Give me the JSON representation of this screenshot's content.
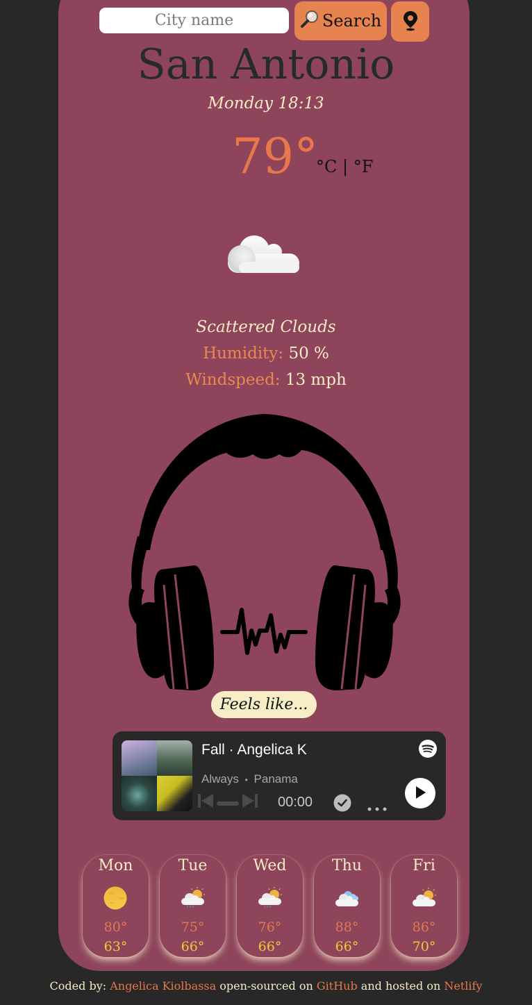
{
  "search": {
    "placeholder": "City name",
    "value": "",
    "button_label": "Search",
    "button_icon": "magnifier-icon",
    "location_icon": "map-pin-icon"
  },
  "current": {
    "city": "San Antonio",
    "datetime": "Monday 18:13",
    "temperature": "79°",
    "unit_celsius": "°C",
    "unit_separator": " | ",
    "unit_fahrenheit": "°F",
    "icon": "scattered-clouds-icon",
    "description": "Scattered Clouds",
    "humidity_label": "Humidity:",
    "humidity_value": "50 %",
    "wind_label": "Windspeed:",
    "wind_value": "13 mph"
  },
  "music": {
    "illustration": "headphones-icon",
    "feels_like_label": "Feels like...",
    "player": {
      "track_title": "Fall · Angelica K",
      "subtitle_song": "Always",
      "subtitle_separator": "•",
      "subtitle_artist": "Panama",
      "time": "00:00"
    }
  },
  "forecast": [
    {
      "day": "Mon",
      "icon": "clear-sun-icon",
      "high": "80°",
      "low": "63°"
    },
    {
      "day": "Tue",
      "icon": "sun-cloud-rain-icon",
      "high": "75°",
      "low": "66°"
    },
    {
      "day": "Wed",
      "icon": "sun-cloud-rain-icon",
      "high": "76°",
      "low": "66°"
    },
    {
      "day": "Thu",
      "icon": "clouds-icon",
      "high": "88°",
      "low": "66°"
    },
    {
      "day": "Fri",
      "icon": "sun-cloud-icon",
      "high": "86°",
      "low": "70°"
    }
  ],
  "footer": {
    "prefix": "Coded by: ",
    "author": "Angelica Kiolbassa",
    "middle": " open-sourced on ",
    "repo": "GitHub",
    "middle2": " and hosted on ",
    "host": "Netlify"
  },
  "colors": {
    "page_bg": "#282828",
    "card_bg": "#8e455c",
    "accent_orange": "#e6834f",
    "cream": "#f7ecc4",
    "low_temp_yellow": "#f5c53a"
  }
}
